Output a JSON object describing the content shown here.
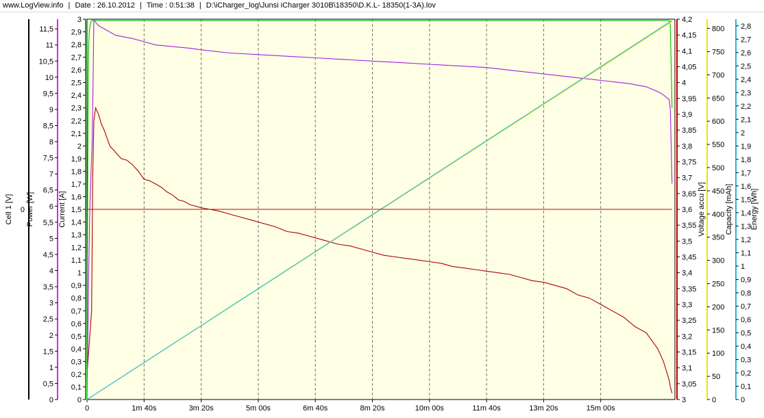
{
  "header": {
    "site": "www.LogView.info",
    "sep": "|",
    "date": "Date : 26.10.2012",
    "time": "Time : 0:51:38",
    "file": "D:\\iCharger_log\\Junsi iCharger 3010B\\18350\\D.K.L- 18350(1-3A).lov"
  },
  "chart_data": {
    "type": "line",
    "plot_background": "#ffffe6",
    "x_axis": {
      "min": 0,
      "max": 1030,
      "ticks": [
        {
          "v": 0,
          "label": "0"
        },
        {
          "v": 100,
          "label": "1m 40s"
        },
        {
          "v": 200,
          "label": "3m 20s"
        },
        {
          "v": 300,
          "label": "5m 00s"
        },
        {
          "v": 400,
          "label": "6m 40s"
        },
        {
          "v": 500,
          "label": "8m 20s"
        },
        {
          "v": 600,
          "label": "10m 00s"
        },
        {
          "v": 700,
          "label": "11m 40s"
        },
        {
          "v": 800,
          "label": "13m 20s"
        },
        {
          "v": 900,
          "label": "15m 00s"
        }
      ]
    },
    "left_axes": [
      {
        "id": "cell1",
        "label": "Cell 1 [V]",
        "zero_label": "0",
        "color": "#000000"
      },
      {
        "id": "power",
        "label": "Power [W]",
        "color": "#e020e0",
        "min": 0,
        "max": 11.8,
        "ticks": [
          "0",
          "0,5",
          "1",
          "1,5",
          "2",
          "2,5",
          "3",
          "3,5",
          "4",
          "4,5",
          "5",
          "5,5",
          "6",
          "6,5",
          "7",
          "7,5",
          "8",
          "8,5",
          "9",
          "9,5",
          "10",
          "10,5",
          "11",
          "11,5"
        ]
      },
      {
        "id": "current",
        "label": "Current [A]",
        "color": "#00bb00",
        "min": 0,
        "max": 3.0,
        "ticks": [
          "0",
          "0,1",
          "0,2",
          "0,3",
          "0,4",
          "0,5",
          "0,6",
          "0,7",
          "0,8",
          "0,9",
          "1",
          "1,1",
          "1,2",
          "1,3",
          "1,4",
          "1,5",
          "1,6",
          "1,7",
          "1,8",
          "1,9",
          "2",
          "2,1",
          "2,2",
          "2,3",
          "2,4",
          "2,5",
          "2,6",
          "2,7",
          "2,8",
          "2,9",
          "3"
        ]
      }
    ],
    "right_axes": [
      {
        "id": "voltage",
        "label": "Voltage accu [V]",
        "color": "#c00000",
        "min": 3.0,
        "max": 4.2,
        "ticks": [
          "3",
          "3,05",
          "3,1",
          "3,15",
          "3,2",
          "3,25",
          "3,3",
          "3,35",
          "3,4",
          "3,45",
          "3,5",
          "3,55",
          "3,6",
          "3,65",
          "3,7",
          "3,75",
          "3,8",
          "3,85",
          "3,9",
          "3,95",
          "4",
          "4,05",
          "4,1",
          "4,15",
          "4,2"
        ]
      },
      {
        "id": "capacity",
        "label": "Capacity [mAh]",
        "color": "#e8e800",
        "min": 0,
        "max": 820,
        "ticks": [
          "0",
          "50",
          "100",
          "150",
          "200",
          "250",
          "300",
          "350",
          "400",
          "450",
          "500",
          "550",
          "600",
          "650",
          "700",
          "750",
          "800"
        ]
      },
      {
        "id": "energy",
        "label": "Energy [Wh]",
        "color": "#20b8d8",
        "min": 0,
        "max": 2.85,
        "ticks": [
          "0",
          "0,1",
          "0,2",
          "0,3",
          "0,4",
          "0,5",
          "0,6",
          "0,7",
          "0,8",
          "0,9",
          "1",
          "1,1",
          "1,2",
          "1,3",
          "1,4",
          "1,5",
          "1,6",
          "1,7",
          "1,8",
          "1,9",
          "2",
          "2,1",
          "2,2",
          "2,3",
          "2,4",
          "2,5",
          "2,6",
          "2,7",
          "2,8"
        ]
      }
    ],
    "series": [
      {
        "id": "voltage",
        "axis": "voltage",
        "color": "#aa0000",
        "x": [
          0,
          8,
          10,
          12,
          15,
          20,
          25,
          30,
          40,
          50,
          60,
          70,
          80,
          90,
          100,
          110,
          120,
          130,
          140,
          150,
          160,
          170,
          180,
          190,
          200,
          215,
          230,
          250,
          270,
          290,
          310,
          330,
          350,
          370,
          390,
          400,
          420,
          440,
          460,
          480,
          500,
          520,
          540,
          560,
          580,
          600,
          620,
          640,
          660,
          680,
          700,
          720,
          740,
          760,
          780,
          800,
          820,
          840,
          860,
          880,
          900,
          920,
          940,
          960,
          980,
          1000,
          1010,
          1015,
          1020,
          1022,
          1025
        ],
        "y": [
          3.08,
          3.28,
          3.7,
          3.88,
          3.92,
          3.9,
          3.87,
          3.85,
          3.8,
          3.78,
          3.76,
          3.755,
          3.74,
          3.72,
          3.695,
          3.69,
          3.68,
          3.67,
          3.655,
          3.645,
          3.63,
          3.625,
          3.615,
          3.61,
          3.605,
          3.6,
          3.595,
          3.585,
          3.575,
          3.565,
          3.555,
          3.545,
          3.53,
          3.525,
          3.515,
          3.51,
          3.5,
          3.49,
          3.485,
          3.475,
          3.465,
          3.455,
          3.45,
          3.445,
          3.44,
          3.435,
          3.43,
          3.42,
          3.415,
          3.41,
          3.405,
          3.4,
          3.395,
          3.385,
          3.375,
          3.37,
          3.36,
          3.35,
          3.33,
          3.32,
          3.3,
          3.28,
          3.26,
          3.23,
          3.21,
          3.16,
          3.12,
          3.09,
          3.06,
          3.04,
          3.02
        ]
      },
      {
        "id": "power",
        "axis": "power",
        "color": "#a020e0",
        "x": [
          0,
          3,
          5,
          7,
          9,
          10,
          11,
          12,
          15,
          20,
          30,
          50,
          80,
          100,
          120,
          150,
          180,
          200,
          250,
          300,
          350,
          400,
          450,
          500,
          550,
          600,
          650,
          700,
          750,
          800,
          850,
          900,
          950,
          980,
          1000,
          1010,
          1020,
          1022,
          1025
        ],
        "y": [
          0,
          4.0,
          6.0,
          7.0,
          8.0,
          9.0,
          10.5,
          11.8,
          11.7,
          11.6,
          11.5,
          11.3,
          11.2,
          11.1,
          11.0,
          10.95,
          10.9,
          10.85,
          10.75,
          10.7,
          10.65,
          10.6,
          10.55,
          10.5,
          10.45,
          10.4,
          10.35,
          10.3,
          10.2,
          10.1,
          10.0,
          9.9,
          9.8,
          9.7,
          9.55,
          9.45,
          9.3,
          9.0,
          6.7
        ]
      },
      {
        "id": "current",
        "axis": "current",
        "color": "#00bb00",
        "x": [
          0,
          1,
          2,
          3,
          4,
          5,
          6,
          7,
          8,
          10,
          15,
          20,
          100,
          200,
          300,
          400,
          500,
          600,
          700,
          800,
          900,
          1000,
          1015,
          1020,
          1022,
          1025
        ],
        "y": [
          0,
          1.5,
          2.5,
          2.8,
          2.9,
          2.94,
          2.96,
          2.98,
          2.99,
          2.99,
          2.99,
          2.99,
          2.99,
          2.99,
          2.99,
          2.99,
          2.99,
          2.99,
          2.99,
          2.99,
          2.99,
          2.99,
          2.99,
          2.99,
          2.95,
          2.3
        ]
      },
      {
        "id": "capacity",
        "axis": "capacity",
        "color": "#e8e800",
        "x": [
          0,
          1025
        ],
        "y": [
          0,
          815
        ]
      },
      {
        "id": "energy",
        "axis": "energy",
        "color": "#20b8d8",
        "x": [
          0,
          1025
        ],
        "y": [
          0,
          2.84
        ]
      },
      {
        "id": "cell1",
        "axis": "cell1",
        "color": "#c00000",
        "x": [
          0,
          1025
        ],
        "y": [
          0,
          0
        ]
      }
    ]
  }
}
